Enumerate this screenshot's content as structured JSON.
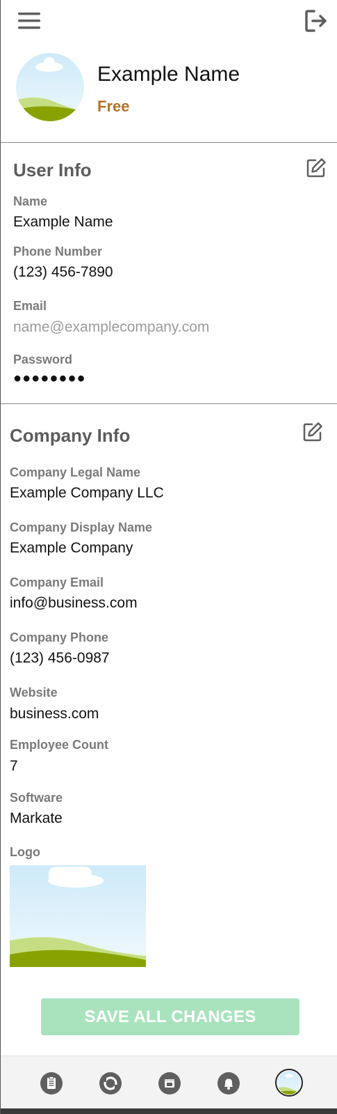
{
  "profile": {
    "name": "Example Name",
    "plan": "Free"
  },
  "user_info": {
    "title": "User Info",
    "fields": {
      "name": {
        "label": "Name",
        "value": "Example Name"
      },
      "phone": {
        "label": "Phone Number",
        "value": "(123) 456-7890"
      },
      "email": {
        "label": "Email",
        "value": "name@examplecompany.com"
      },
      "password": {
        "label": "Password",
        "value": "●●●●●●●●"
      }
    }
  },
  "company_info": {
    "title": "Company Info",
    "fields": {
      "legal_name": {
        "label": "Company Legal Name",
        "value": "Example Company LLC"
      },
      "display_name": {
        "label": "Company Display Name",
        "value": "Example Company"
      },
      "email": {
        "label": "Company Email",
        "value": "info@business.com"
      },
      "phone": {
        "label": "Company Phone",
        "value": "(123) 456-0987"
      },
      "website": {
        "label": "Website",
        "value": "business.com"
      },
      "employee_count": {
        "label": "Employee Count",
        "value": "7"
      },
      "software": {
        "label": "Software",
        "value": "Markate"
      },
      "logo": {
        "label": "Logo"
      }
    }
  },
  "actions": {
    "save_all": "SAVE ALL CHANGES"
  },
  "icons": {
    "menu": "hamburger-icon",
    "logout": "logout-icon",
    "edit": "edit-icon",
    "nav": [
      "clipboard-icon",
      "refresh-icon",
      "store-icon",
      "bell-icon",
      "profile-avatar-icon"
    ]
  },
  "colors": {
    "plan": "#b07327",
    "save_button": "#a9e3be",
    "section_title": "#5c5c5c",
    "label": "#7a7a7a",
    "muted_value": "#9b9b9b",
    "nav_icon": "#5f5f5f"
  }
}
